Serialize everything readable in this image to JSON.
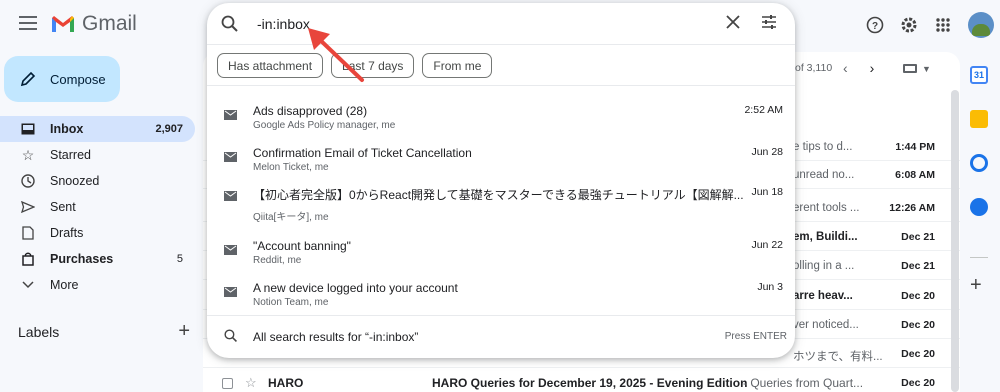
{
  "app": {
    "name": "Gmail"
  },
  "compose_label": "Compose",
  "sidebar": {
    "items": [
      {
        "label": "Inbox",
        "count": "2,907"
      },
      {
        "label": "Starred",
        "count": ""
      },
      {
        "label": "Snoozed",
        "count": ""
      },
      {
        "label": "Sent",
        "count": ""
      },
      {
        "label": "Drafts",
        "count": ""
      },
      {
        "label": "Purchases",
        "count": "5"
      },
      {
        "label": "More",
        "count": ""
      }
    ],
    "labels_heading": "Labels"
  },
  "search": {
    "value": "-in:inbox",
    "chips": [
      "Has attachment",
      "Last 7 days",
      "From me"
    ],
    "suggestions": [
      {
        "title": "Ads disapproved (28)",
        "sub": "Google Ads Policy manager, me",
        "date": "2:52 AM"
      },
      {
        "title": "Confirmation Email of Ticket Cancellation",
        "sub": "Melon Ticket, me",
        "date": "Jun 28"
      },
      {
        "title": "【初心者完全版】0からReact開発して基礎をマスターできる最強チュートリアル【図解解...",
        "sub": "Qiita[キータ], me",
        "date": "Jun 18"
      },
      {
        "title": "\"Account banning\"",
        "sub": "Reddit, me",
        "date": "Jun 22"
      },
      {
        "title": "A new device logged into your account",
        "sub": "Notion Team, me",
        "date": "Jun 3"
      }
    ],
    "all_results": "All search results for “-in:inbox”",
    "press_enter": "Press ENTER"
  },
  "list": {
    "pager": "of 3,110",
    "rows": [
      {
        "snippet": "e tips to d...",
        "date": "1:44 PM",
        "bold": false
      },
      {
        "snippet": "unread no...",
        "date": "6:08 AM",
        "bold": false
      },
      {
        "snippet": "erent tools ...",
        "date": "12:26 AM",
        "bold": false
      },
      {
        "snippet": "em, Buildi...",
        "date": "Dec 21",
        "bold": true
      },
      {
        "snippet": "olling in a ...",
        "date": "Dec 21",
        "bold": false
      },
      {
        "snippet": "arre heav...",
        "date": "Dec 20",
        "bold": true
      },
      {
        "snippet": "ver noticed...",
        "date": "Dec 20",
        "bold": false
      },
      {
        "snippet": "ホツまで、有料...",
        "date": "Dec 20",
        "bold": false
      }
    ],
    "bottom_row": {
      "from": "HARO",
      "subject": "HARO Queries for December 19, 2025 - Evening Edition",
      "snippet": "- Queries from Quart...",
      "date": "Dec 20"
    }
  },
  "colors": {
    "accent": "#c2e7ff",
    "active_nav": "#d3e3fd",
    "annotation_arrow": "#e8453c",
    "gmail_red": "#ea4335"
  },
  "icons": [
    "menu-icon",
    "gmail-logo-icon",
    "help-icon",
    "settings-icon",
    "apps-icon",
    "search-icon",
    "close-icon",
    "tune-icon",
    "mail-icon",
    "calendar-icon",
    "keep-icon",
    "tasks-icon",
    "contacts-icon",
    "plus-icon"
  ]
}
